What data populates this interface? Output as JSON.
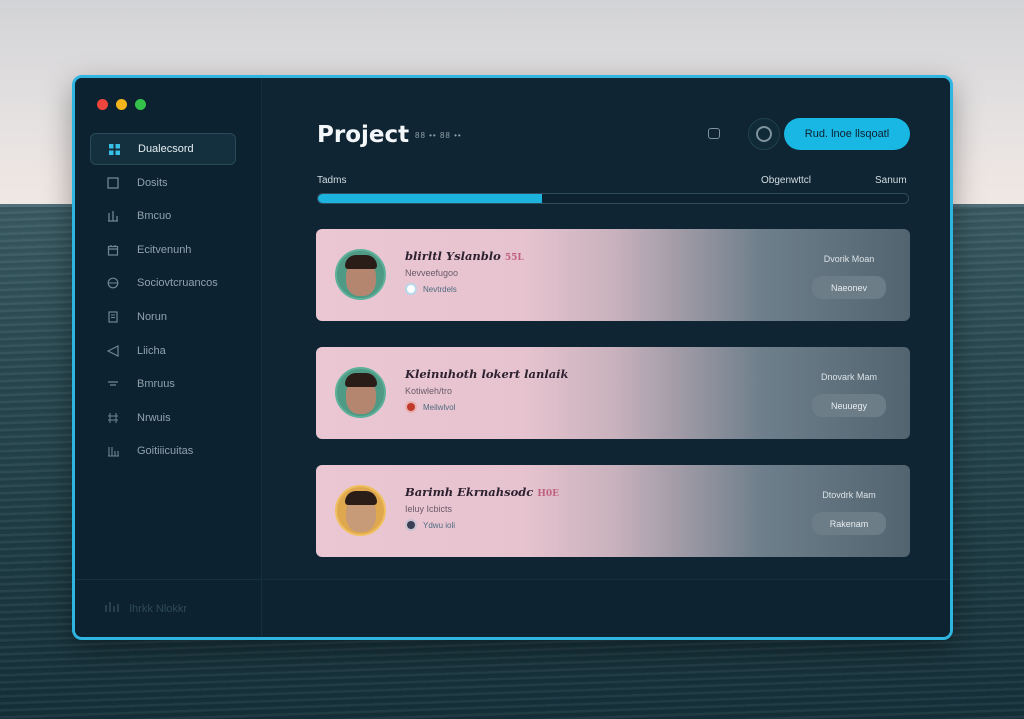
{
  "window": {
    "title": "Project",
    "subtitle": "88 •• 88 ••"
  },
  "header": {
    "cta_label": "Rud. lnoe llsqoatl"
  },
  "sidebar": {
    "items": [
      {
        "label": "Dualecsord",
        "icon": "dashboard-icon"
      },
      {
        "label": "Dosits",
        "icon": "square-icon"
      },
      {
        "label": "Bmcuo",
        "icon": "chart-icon"
      },
      {
        "label": "Ecitvenunh",
        "icon": "calendar-icon"
      },
      {
        "label": "Sociovtcruancos",
        "icon": "globe-icon"
      },
      {
        "label": "Norun",
        "icon": "document-icon"
      },
      {
        "label": "Liicha",
        "icon": "send-icon"
      },
      {
        "label": "Bmruus",
        "icon": "list-icon"
      },
      {
        "label": "Nrwuis",
        "icon": "grid-icon"
      },
      {
        "label": "Goitiiicuitas",
        "icon": "team-icon"
      }
    ],
    "footer_label": "Ihrkk Nlokkr"
  },
  "progress": {
    "left_label": "Tadms",
    "mid_label": "Obgenwttcl",
    "right_label": "Sanum",
    "value": 0.38
  },
  "cards": [
    {
      "name": "blirltl Yslanblo",
      "name_extra": "55L",
      "role": "Nevveefugoo",
      "tag": "Nevtrdels",
      "status": "Dvorik Moan",
      "button": "Naeonev"
    },
    {
      "name": "Kleinuhoth lokert lanlaik",
      "name_extra": "",
      "role": "Kotiwleh/tro",
      "tag": "Meilwlvol",
      "status": "Dnovark Mam",
      "button": "Neuuegy"
    },
    {
      "name": "Barimh Ekrnahsodc",
      "name_extra": "H0E",
      "role": "Ieluy Icbicts",
      "tag": "Ydwu ioli",
      "status": "Dtovdrk Mam",
      "button": "Rakenam"
    }
  ],
  "colors": {
    "accent": "#19b7e4",
    "window_border": "#2fb6e0",
    "window_bg": "#0f2533"
  }
}
